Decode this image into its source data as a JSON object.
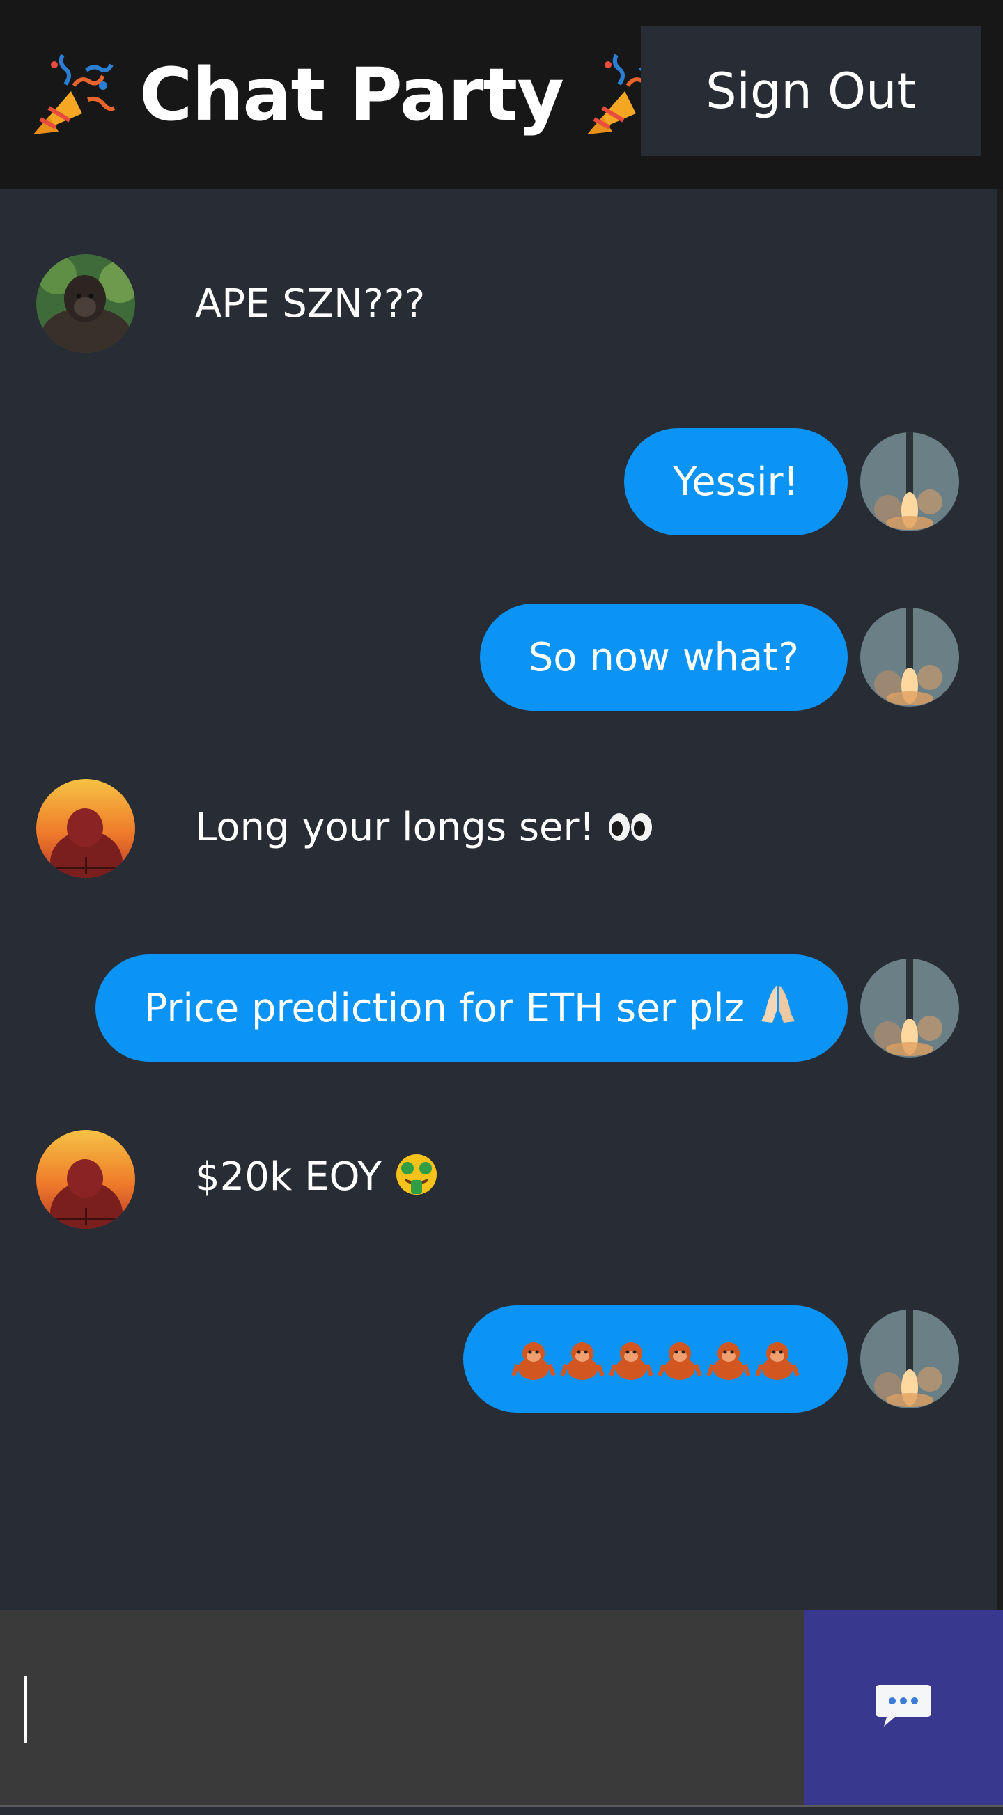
{
  "header": {
    "title": "Chat Party",
    "left_icon": "party-popper-icon",
    "right_icon": "party-popper-icon",
    "signout_label": "Sign Out"
  },
  "messages": [
    {
      "direction": "received",
      "text": "APE SZN???",
      "avatar": "gorilla-photo-avatar"
    },
    {
      "direction": "sent",
      "text": "Yessir!",
      "avatar": "rocket-launch-avatar"
    },
    {
      "direction": "sent",
      "text": "So now what?",
      "avatar": "rocket-launch-avatar"
    },
    {
      "direction": "received",
      "text": "Long your longs ser!",
      "emoji": "eyes-emoji",
      "avatar": "sunset-gorilla-avatar"
    },
    {
      "direction": "sent",
      "text": "Price prediction for ETH ser plz",
      "emoji": "folded-hands-emoji",
      "avatar": "rocket-launch-avatar"
    },
    {
      "direction": "received",
      "text": "$20k EOY",
      "emoji": "money-mouth-face-emoji",
      "avatar": "sunset-gorilla-avatar"
    },
    {
      "direction": "sent",
      "text": "",
      "emoji": "orangutan-emoji x6",
      "avatar": "rocket-launch-avatar"
    }
  ],
  "composer": {
    "value": "",
    "placeholder": "",
    "send_icon": "speech-balloon-icon"
  },
  "colors": {
    "header_bg": "#181717",
    "chat_bg": "#282c34",
    "bubble_sent": "#0b93f6",
    "input_bg": "#3a3a3a",
    "send_bg": "#38388f"
  }
}
